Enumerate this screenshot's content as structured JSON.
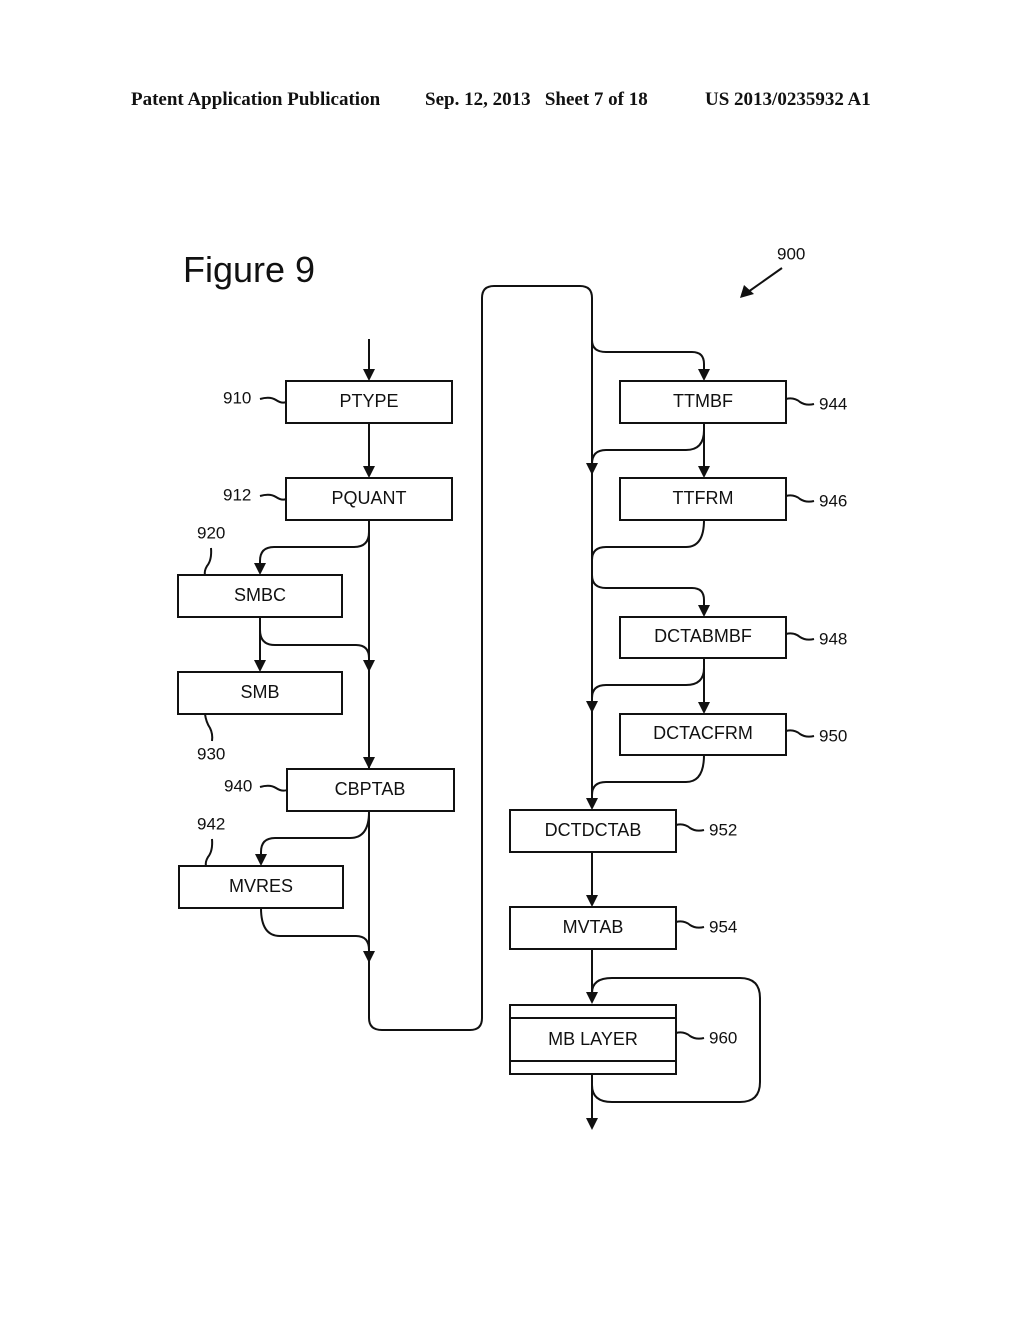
{
  "header": {
    "publication": "Patent Application Publication",
    "date_sheet": "Sep. 12, 2013   Sheet 7 of 18",
    "patent_number": "US 2013/0235932 A1"
  },
  "figure": {
    "title": "Figure 9",
    "ref": "900"
  },
  "boxes": {
    "ptype": {
      "label": "PTYPE",
      "ref": "910"
    },
    "pquant": {
      "label": "PQUANT",
      "ref": "912"
    },
    "smbc": {
      "label": "SMBC",
      "ref": "920"
    },
    "smb": {
      "label": "SMB",
      "ref": "930"
    },
    "cbptab": {
      "label": "CBPTAB",
      "ref": "940"
    },
    "mvres": {
      "label": "MVRES",
      "ref": "942"
    },
    "ttmbf": {
      "label": "TTMBF",
      "ref": "944"
    },
    "ttfrm": {
      "label": "TTFRM",
      "ref": "946"
    },
    "dctabmbf": {
      "label": "DCTABMBF",
      "ref": "948"
    },
    "dctacfrm": {
      "label": "DCTACFRM",
      "ref": "950"
    },
    "dctdctab": {
      "label": "DCTDCTAB",
      "ref": "952"
    },
    "mvtab": {
      "label": "MVTAB",
      "ref": "954"
    },
    "mblayer": {
      "label": "MB LAYER",
      "ref": "960"
    }
  }
}
